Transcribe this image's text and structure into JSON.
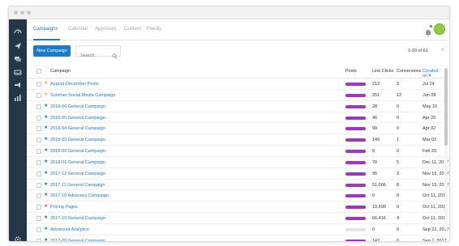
{
  "colors": {
    "accent": "#1a7bc8",
    "sidebar": "#253746",
    "post_bar": "#a233c7",
    "star_yellow": "#f5c02b",
    "star_blue": "#1a7bc8",
    "star_red": "#e05b5b",
    "avatar": "#8fcf3e"
  },
  "nav": {
    "tabs": [
      "Campaigns",
      "Calendar",
      "Approvals",
      "Content",
      "Feedly"
    ],
    "active_tab": "Campaigns"
  },
  "sidebar": {
    "icons": [
      "dashboard-icon",
      "send-icon",
      "messages-icon",
      "inbox-icon",
      "megaphone-icon",
      "analytics-icon",
      "settings-icon"
    ]
  },
  "toolbar": {
    "new_campaign_label": "New Campaign",
    "search_placeholder": "Search",
    "pagination": "1-20 of 61",
    "prev_label": "‹",
    "next_label": "›"
  },
  "table": {
    "columns": {
      "campaign": "Campaign",
      "posts": "Posts",
      "clicks": "Link Clicks",
      "conversions": "Conversions",
      "created": "Created on ▾"
    },
    "rows": [
      {
        "star": "yellow",
        "name": "August-December Posts",
        "posts_filled": true,
        "clicks": "212",
        "conversions": "3",
        "created": "Jul 24"
      },
      {
        "star": "yellow",
        "name": "Summer Social Media Campaign",
        "posts_filled": true,
        "clicks": "251",
        "conversions": "12",
        "created": "Jun 08"
      },
      {
        "star": "blue",
        "name": "2018-06 General Campaign",
        "posts_filled": true,
        "clicks": "28",
        "conversions": "0",
        "created": "May 10"
      },
      {
        "star": "blue",
        "name": "2018-05 General Campaign",
        "posts_filled": true,
        "clicks": "46",
        "conversions": "0",
        "created": "Apr 20"
      },
      {
        "star": "blue",
        "name": "2018-04 General Campaign",
        "posts_filled": true,
        "clicks": "99",
        "conversions": "0",
        "created": "Apr 02"
      },
      {
        "star": "blue",
        "name": "2018-03 General Campaign",
        "posts_filled": true,
        "clicks": "149",
        "conversions": "1",
        "created": "Mar 02"
      },
      {
        "star": "blue",
        "name": "2018-02 General Campaign",
        "posts_filled": true,
        "clicks": "9",
        "conversions": "0",
        "created": "Feb 20"
      },
      {
        "star": "blue",
        "name": "2018-01 General Campaign",
        "posts_filled": true,
        "clicks": "78",
        "conversions": "5",
        "created": "Dec 11, 2017"
      },
      {
        "star": "blue",
        "name": "2017-12 General Campaign",
        "posts_filled": true,
        "clicks": "95",
        "conversions": "3",
        "created": "Nov 16, 2017"
      },
      {
        "star": "blue",
        "name": "2017-11 General Campaign",
        "posts_filled": true,
        "clicks": "51,006",
        "conversions": "8",
        "created": "Nov 15, 2017"
      },
      {
        "star": "blue",
        "name": "2017-10 Advocacy Campaign",
        "posts_filled": true,
        "clicks": "0",
        "conversions": "0",
        "created": "Oct 11, 2017"
      },
      {
        "star": "red",
        "name": "Pricing Pages",
        "posts_filled": true,
        "clicks": "10,690",
        "conversions": "0",
        "created": "Oct 11, 2017"
      },
      {
        "star": "blue",
        "name": "2017-10 General Campaign",
        "posts_filled": true,
        "clicks": "66,416",
        "conversions": "4",
        "created": "Oct 11, 2017"
      },
      {
        "star": "blue",
        "name": "Advanced Analytics",
        "posts_filled": false,
        "clicks": "0",
        "conversions": "0",
        "created": "Sep 22, 2017"
      },
      {
        "star": "blue",
        "name": "2017-09 General Campaign",
        "posts_filled": true,
        "clicks": "142",
        "conversions": "6",
        "created": "Sep 1, 2017"
      }
    ]
  }
}
